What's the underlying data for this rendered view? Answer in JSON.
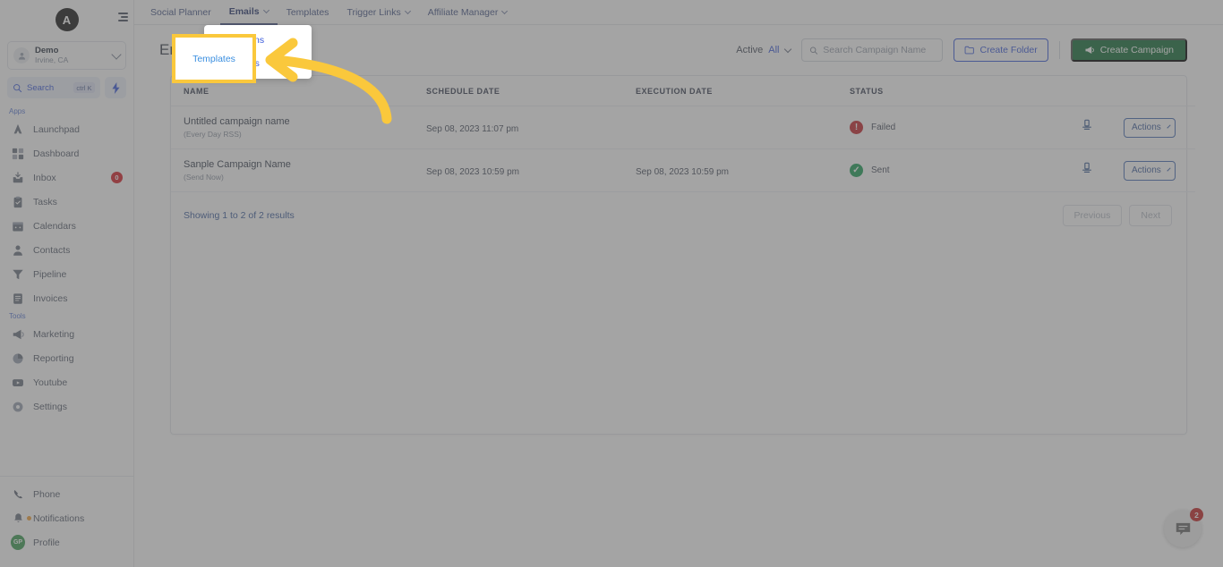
{
  "app": {
    "logo_letter": "A",
    "workspace": {
      "name": "Demo",
      "location": "Irvine, CA"
    },
    "search": {
      "label": "Search",
      "shortcut": "ctrl K"
    }
  },
  "sidebar": {
    "sections": [
      {
        "label": "Apps",
        "items": [
          {
            "label": "Launchpad",
            "icon": "rocket-icon",
            "badge": ""
          },
          {
            "label": "Dashboard",
            "icon": "grid-icon",
            "badge": ""
          },
          {
            "label": "Inbox",
            "icon": "inbox-icon",
            "badge": "0"
          },
          {
            "label": "Tasks",
            "icon": "clipboard-check-icon",
            "badge": ""
          },
          {
            "label": "Calendars",
            "icon": "calendar-icon",
            "badge": ""
          },
          {
            "label": "Contacts",
            "icon": "person-icon",
            "badge": ""
          },
          {
            "label": "Pipeline",
            "icon": "funnel-icon",
            "badge": ""
          },
          {
            "label": "Invoices",
            "icon": "invoice-icon",
            "badge": ""
          }
        ]
      },
      {
        "label": "Tools",
        "items": [
          {
            "label": "Marketing",
            "icon": "megaphone-icon",
            "badge": ""
          },
          {
            "label": "Reporting",
            "icon": "pie-chart-icon",
            "badge": ""
          },
          {
            "label": "Youtube",
            "icon": "video-icon",
            "badge": ""
          },
          {
            "label": "Settings",
            "icon": "gear-icon",
            "badge": ""
          }
        ]
      }
    ],
    "bottom_items": [
      {
        "label": "Phone",
        "icon": "phone-icon"
      },
      {
        "label": "Notifications",
        "icon": "bell-icon"
      },
      {
        "label": "Profile",
        "icon": "avatar-icon",
        "initials": "GP"
      }
    ]
  },
  "topnav": {
    "items": [
      {
        "label": "Social Planner",
        "has_caret": false,
        "active": false
      },
      {
        "label": "Emails",
        "has_caret": true,
        "active": true
      },
      {
        "label": "Templates",
        "has_caret": false,
        "active": false
      },
      {
        "label": "Trigger Links",
        "has_caret": true,
        "active": false
      },
      {
        "label": "Affiliate Manager",
        "has_caret": true,
        "active": false
      }
    ],
    "dropdown": {
      "open_for": "Emails",
      "items": [
        {
          "label": "Campaigns"
        },
        {
          "label": "Templates"
        }
      ]
    }
  },
  "page": {
    "title": "Email Campaigns",
    "filter": {
      "label": "Active",
      "value": "All"
    },
    "search": {
      "placeholder": "Search Campaign Name",
      "value": ""
    },
    "create_folder_label": "Create Folder",
    "create_campaign_label": "Create Campaign"
  },
  "table": {
    "columns": [
      "NAME",
      "SCHEDULE DATE",
      "EXECUTION DATE",
      "STATUS"
    ],
    "rows": [
      {
        "name": "Untitled campaign name",
        "sub": "(Every Day RSS)",
        "schedule_date": "Sep 08, 2023 11:07 pm",
        "execution_date": "",
        "status": "Failed",
        "status_icon": "exclamation-circle-icon",
        "actions_label": "Actions"
      },
      {
        "name": "Sanple Campaign Name",
        "sub": "(Send Now)",
        "schedule_date": "Sep 08, 2023 10:59 pm",
        "execution_date": "Sep 08, 2023 10:59 pm",
        "status": "Sent",
        "status_icon": "check-circle-icon",
        "actions_label": "Actions"
      }
    ]
  },
  "pagination": {
    "info": "Showing 1 to 2 of 2 results",
    "previous_label": "Previous",
    "next_label": "Next"
  },
  "annotation": {
    "highlight_label": "Templates",
    "highlight_color": "#fac83c",
    "arrow_color": "#fac83c"
  },
  "chat": {
    "unread_count": "2"
  },
  "colors": {
    "accent_blue": "#3b5bdb",
    "green_button": "#18703a",
    "status_failed": "#c5292f",
    "status_sent": "#21a15a",
    "highlight_yellow": "#fac83c"
  }
}
